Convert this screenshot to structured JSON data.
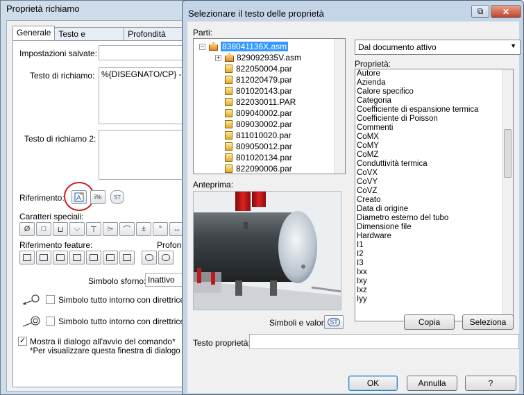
{
  "background_dialog": {
    "title": "Proprietà richiamo",
    "tabs": [
      "Generale",
      "Testo e riferimento",
      "Profondità Smart"
    ],
    "saved_settings_label": "Impostazioni salvate:",
    "callout_text_label": "Testo di richiamo:",
    "callout_text_value": "%{DISEGNATO/CP} - %",
    "callout_text2_label": "Testo di richiamo 2:",
    "reference_label": "Riferimento:",
    "special_chars_label": "Caratteri speciali:",
    "feature_ref_label": "Riferimento feature:",
    "depth_label": "Profondi",
    "relief_symbol_label": "Simbolo sforno:",
    "relief_symbol_value": "Inattivo",
    "all_around_1": "Simbolo tutto intorno con direttrice",
    "all_around_2": "Simbolo tutto intorno con direttrice",
    "show_dialog_label": "Mostra il dialogo all'avvio del comando*",
    "footnote": "*Per visualizzare questa finestra di dialogo fare",
    "special_chars": [
      "Ø",
      "□",
      "⊔",
      "⌵",
      "⊤",
      "⌲",
      "⌒",
      "±",
      "°",
      "↔",
      "⊕"
    ],
    "st_label": "ST"
  },
  "dialog": {
    "title": "Selezionare il testo delle proprietà",
    "parts_label": "Parti:",
    "tree": [
      {
        "label": "838041136X.asm",
        "type": "asm",
        "level": 0,
        "selected": true,
        "expander": "−"
      },
      {
        "label": "829092935V.asm",
        "type": "asm",
        "level": 1,
        "selected": false,
        "expander": "+"
      },
      {
        "label": "822050004.par",
        "type": "part",
        "level": 1,
        "selected": false,
        "expander": ""
      },
      {
        "label": "812020479.par",
        "type": "part",
        "level": 1,
        "selected": false,
        "expander": ""
      },
      {
        "label": "801020143.par",
        "type": "part",
        "level": 1,
        "selected": false,
        "expander": ""
      },
      {
        "label": "822030011.PAR",
        "type": "part",
        "level": 1,
        "selected": false,
        "expander": ""
      },
      {
        "label": "809040002.par",
        "type": "part",
        "level": 1,
        "selected": false,
        "expander": ""
      },
      {
        "label": "809030002.par",
        "type": "part",
        "level": 1,
        "selected": false,
        "expander": ""
      },
      {
        "label": "811010020.par",
        "type": "part",
        "level": 1,
        "selected": false,
        "expander": ""
      },
      {
        "label": "809050012.par",
        "type": "part",
        "level": 1,
        "selected": false,
        "expander": ""
      },
      {
        "label": "801020134.par",
        "type": "part",
        "level": 1,
        "selected": false,
        "expander": ""
      },
      {
        "label": "822090006.par",
        "type": "part",
        "level": 1,
        "selected": false,
        "expander": ""
      }
    ],
    "source_select": "Dal documento attivo",
    "properties_label": "Proprietà:",
    "properties": [
      "Autore",
      "Azienda",
      "Calore specifico",
      "Categoria",
      "Coefficiente di espansione termica",
      "Coefficiente di Poisson",
      "Commenti",
      "CoMX",
      "CoMY",
      "CoMZ",
      "Conduttività termica",
      "CoVX",
      "CoVY",
      "CoVZ",
      "Creato",
      "Data di origine",
      "Diametro esterno del tubo",
      "Dimensione file",
      "Hardware",
      "I1",
      "I2",
      "I3",
      "Ixx",
      "Ixy",
      "Ixz",
      "Iyy"
    ],
    "preview_label": "Anteprima:",
    "symbols_label": "Simboli e valori:",
    "st_label": "ST",
    "copy_button": "Copia",
    "select_button": "Seleziona",
    "property_text_label": "Testo proprietà:",
    "property_text_value": "",
    "ok_button": "OK",
    "cancel_button": "Annulla",
    "help_button": "?",
    "caption_restore": "⧉",
    "caption_close": "✕"
  }
}
